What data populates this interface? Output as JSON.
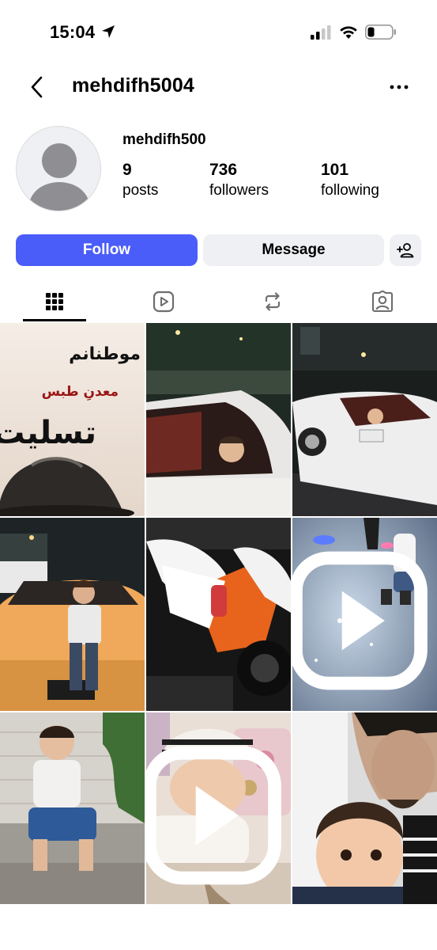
{
  "status_bar": {
    "time": "15:04",
    "icons": [
      "location-arrow-icon",
      "cellular-signal-icon",
      "wifi-icon",
      "battery-icon"
    ]
  },
  "header": {
    "username": "mehdifh5004",
    "back_icon": "chevron-left-icon",
    "more_icon": "more-horizontal-icon"
  },
  "profile": {
    "display_name": "mehdifh500",
    "stats": {
      "posts": {
        "count": "9",
        "label": "posts"
      },
      "followers": {
        "count": "736",
        "label": "followers"
      },
      "following": {
        "count": "101",
        "label": "following"
      }
    }
  },
  "actions": {
    "follow_label": "Follow",
    "message_label": "Message",
    "suggest_icon": "add-person-icon"
  },
  "tabs": [
    {
      "name": "posts-grid",
      "icon": "grid-icon",
      "active": true
    },
    {
      "name": "reels",
      "icon": "reels-icon",
      "active": false
    },
    {
      "name": "reposts",
      "icon": "repost-icon",
      "active": false
    },
    {
      "name": "tagged",
      "icon": "tagged-person-icon",
      "active": false
    }
  ],
  "posts": [
    {
      "text_line1": "موطنانم",
      "text_line2": "معدنِ طبس",
      "text_line3": "تسلیت",
      "is_reel": false
    },
    {
      "is_reel": false
    },
    {
      "is_reel": false
    },
    {
      "is_reel": false
    },
    {
      "is_reel": false
    },
    {
      "is_reel": true
    },
    {
      "is_reel": false
    },
    {
      "is_reel": true
    },
    {
      "is_reel": false
    }
  ],
  "colors": {
    "follow_button": "#4a5df9",
    "secondary_button": "#eff0f3"
  }
}
